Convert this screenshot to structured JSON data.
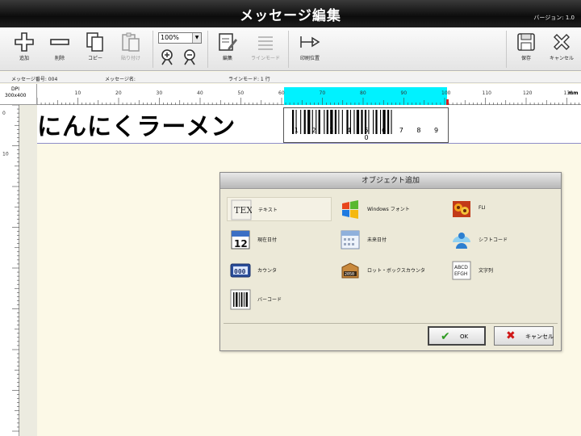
{
  "window": {
    "title": "メッセージ編集",
    "version": "バージョン: 1.0"
  },
  "toolbar": {
    "add_label": "追加",
    "delete_label": "削除",
    "copy_label": "コピー",
    "paste_label": "貼り付け",
    "zoom_value": "100%",
    "edit_label": "編集",
    "line_mode_label": "ラインモード",
    "print_position_label": "印刷位置",
    "save_label": "保存",
    "cancel_label": "キャンセル"
  },
  "info": {
    "message_number": "メッセージ番号: 004",
    "message_name": "メッセージ名:",
    "line_mode": "ラインモード: 1 行"
  },
  "ruler": {
    "dpi_label": "DPI",
    "dpi_value": "300x400",
    "unit": "mm",
    "h_ticks": [
      "10",
      "20",
      "30",
      "40",
      "50",
      "60",
      "70",
      "80",
      "90",
      "100",
      "110",
      "120",
      "130"
    ],
    "v_ticks": [
      "0",
      "10"
    ]
  },
  "canvas": {
    "message_text": "にんにくラーメン",
    "barcode_digits": "1234567890"
  },
  "dialog": {
    "title": "オブジェクト追加",
    "items": [
      {
        "label": "テキスト",
        "icon": "tex-text-icon"
      },
      {
        "label": "Windows フォント",
        "icon": "windows-font-icon"
      },
      {
        "label": "FLI",
        "icon": "flower-image-icon"
      },
      {
        "label": "現在日付",
        "icon": "calendar-icon"
      },
      {
        "label": "未来日付",
        "icon": "future-calendar-icon"
      },
      {
        "label": "シフトコード",
        "icon": "shift-person-icon"
      },
      {
        "label": "カウンタ",
        "icon": "counter-icon"
      },
      {
        "label": "ロット・ボックスカウンタ",
        "icon": "box-counter-icon"
      },
      {
        "label": "文字列",
        "icon": "string-icon"
      },
      {
        "label": "バーコード",
        "icon": "barcode-icon"
      }
    ],
    "ok_label": "OK",
    "cancel_label": "キャンセル"
  },
  "colors": {
    "ruler_highlight": "#00f2ff",
    "ok_check": "#2e9b22",
    "cancel_x": "#d01818"
  }
}
